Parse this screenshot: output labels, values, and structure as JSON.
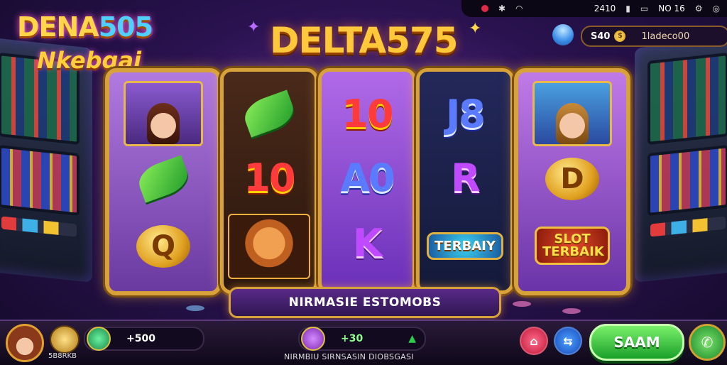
{
  "status_bar": {
    "time": "2410",
    "battery_text": "NO 16"
  },
  "header": {
    "logo_line1": "DENA",
    "logo_line1_accent": "505",
    "logo_line2": "Nkebqai",
    "title": "DELTA575"
  },
  "currency": {
    "coins": "S40",
    "gems_label": "1ladeco00"
  },
  "reels": [
    {
      "symbols": [
        {
          "type": "portrait",
          "icon": "woman-portrait"
        },
        {
          "type": "icon",
          "icon": "green-leaf"
        },
        {
          "type": "icon",
          "icon": "gold-coin",
          "text": "Q"
        }
      ]
    },
    {
      "symbols": [
        {
          "type": "icon",
          "icon": "green-leaf"
        },
        {
          "type": "text",
          "text": "10",
          "color": "red"
        },
        {
          "type": "icon",
          "icon": "shiba-dog"
        }
      ]
    },
    {
      "symbols": [
        {
          "type": "text",
          "text": "10",
          "color": "red"
        },
        {
          "type": "text",
          "text": "A0",
          "color": "blue"
        },
        {
          "type": "text",
          "text": "K",
          "color": "purple"
        }
      ]
    },
    {
      "symbols": [
        {
          "type": "text",
          "text": "J8",
          "color": "blue"
        },
        {
          "type": "text",
          "text": "R",
          "color": "purple"
        },
        {
          "type": "badge",
          "text": "TERBAIY",
          "icon": "globe-badge"
        }
      ]
    },
    {
      "symbols": [
        {
          "type": "portrait",
          "icon": "woman-portrait"
        },
        {
          "type": "icon",
          "icon": "gold-coin",
          "text": "D"
        },
        {
          "type": "badge",
          "text": "SLOT TERBAIK",
          "icon": "slot-badge"
        }
      ]
    }
  ],
  "info_bar": {
    "text": "NIRMASIE ESTOMOBS"
  },
  "bottom_bar": {
    "slot_label": "5B8RKB",
    "balance": "+500",
    "bet": "+30",
    "footer_text": "NIRMBIU SIRNSASIN DIOBSGASI",
    "spin_label": "SAAM"
  },
  "colors": {
    "gold": "#d8a23a",
    "purple": "#5a2c8a",
    "green": "#1aa02a"
  }
}
